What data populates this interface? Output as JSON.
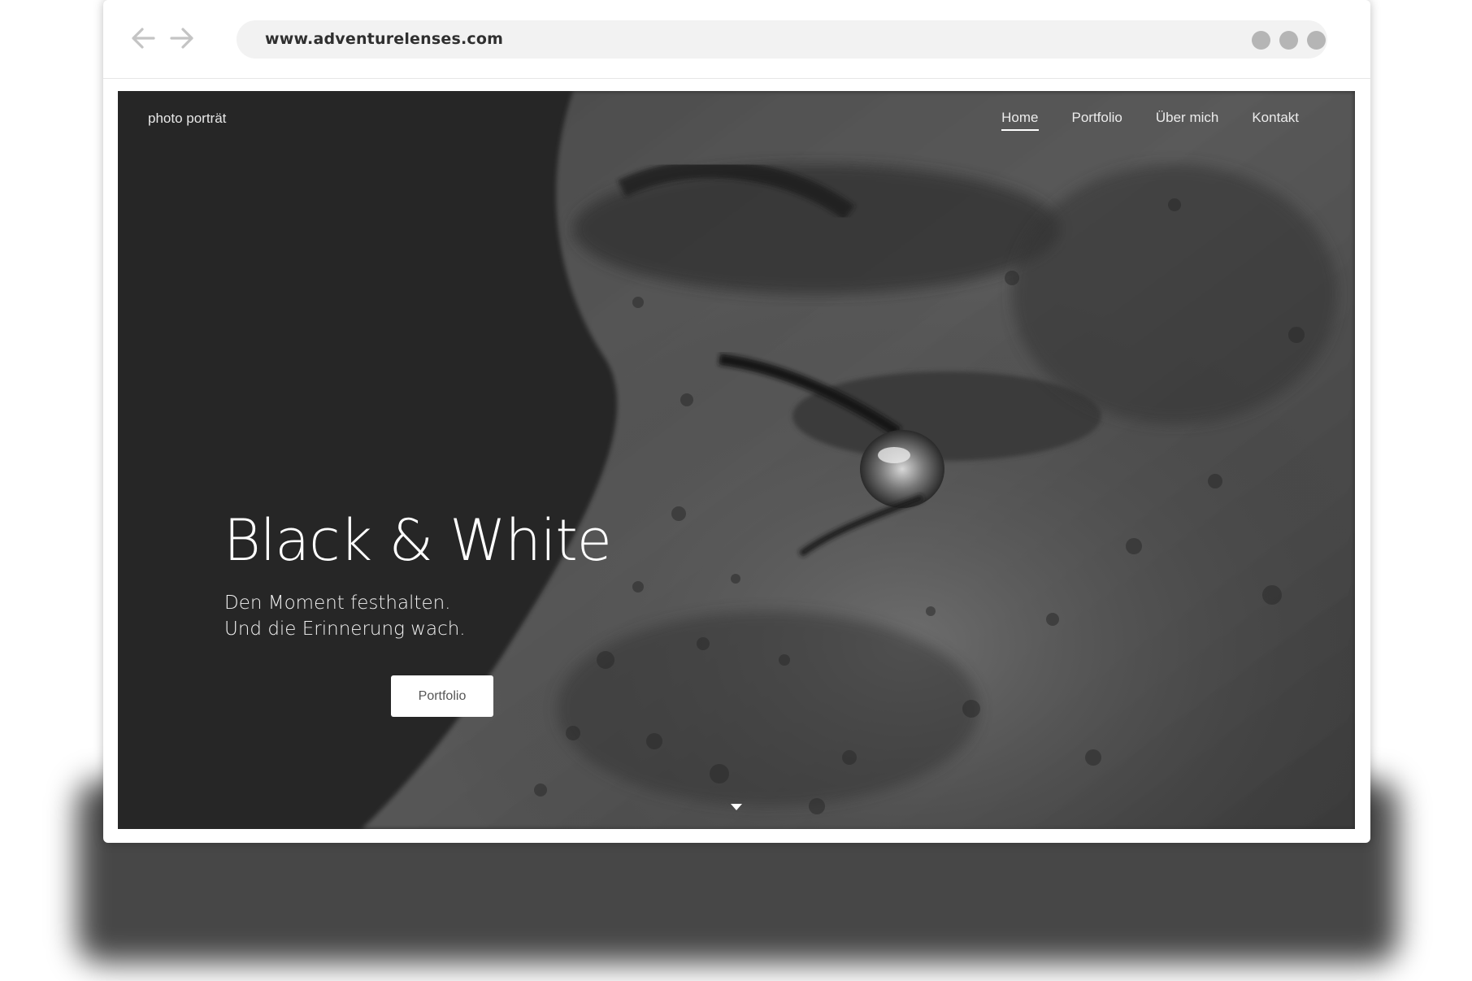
{
  "browser": {
    "url": "www.adventurelenses.com",
    "back_icon": "arrow-left-icon",
    "forward_icon": "arrow-right-icon",
    "menu_dots": 3
  },
  "site": {
    "logo": "photo porträt",
    "nav": [
      {
        "label": "Home",
        "active": true
      },
      {
        "label": "Portfolio",
        "active": false
      },
      {
        "label": "Über mich",
        "active": false
      },
      {
        "label": "Kontakt",
        "active": false
      }
    ]
  },
  "hero": {
    "title": "Black & White",
    "subtitle_line1": "Den Moment festhalten.",
    "subtitle_line2": "Und die Erinnerung wach.",
    "button_label": "Portfolio",
    "scroll_icon": "caret-down-icon"
  },
  "colors": {
    "window": "#ffffff",
    "url_bar": "#f2f2f2",
    "hero_dark": "#262626"
  }
}
